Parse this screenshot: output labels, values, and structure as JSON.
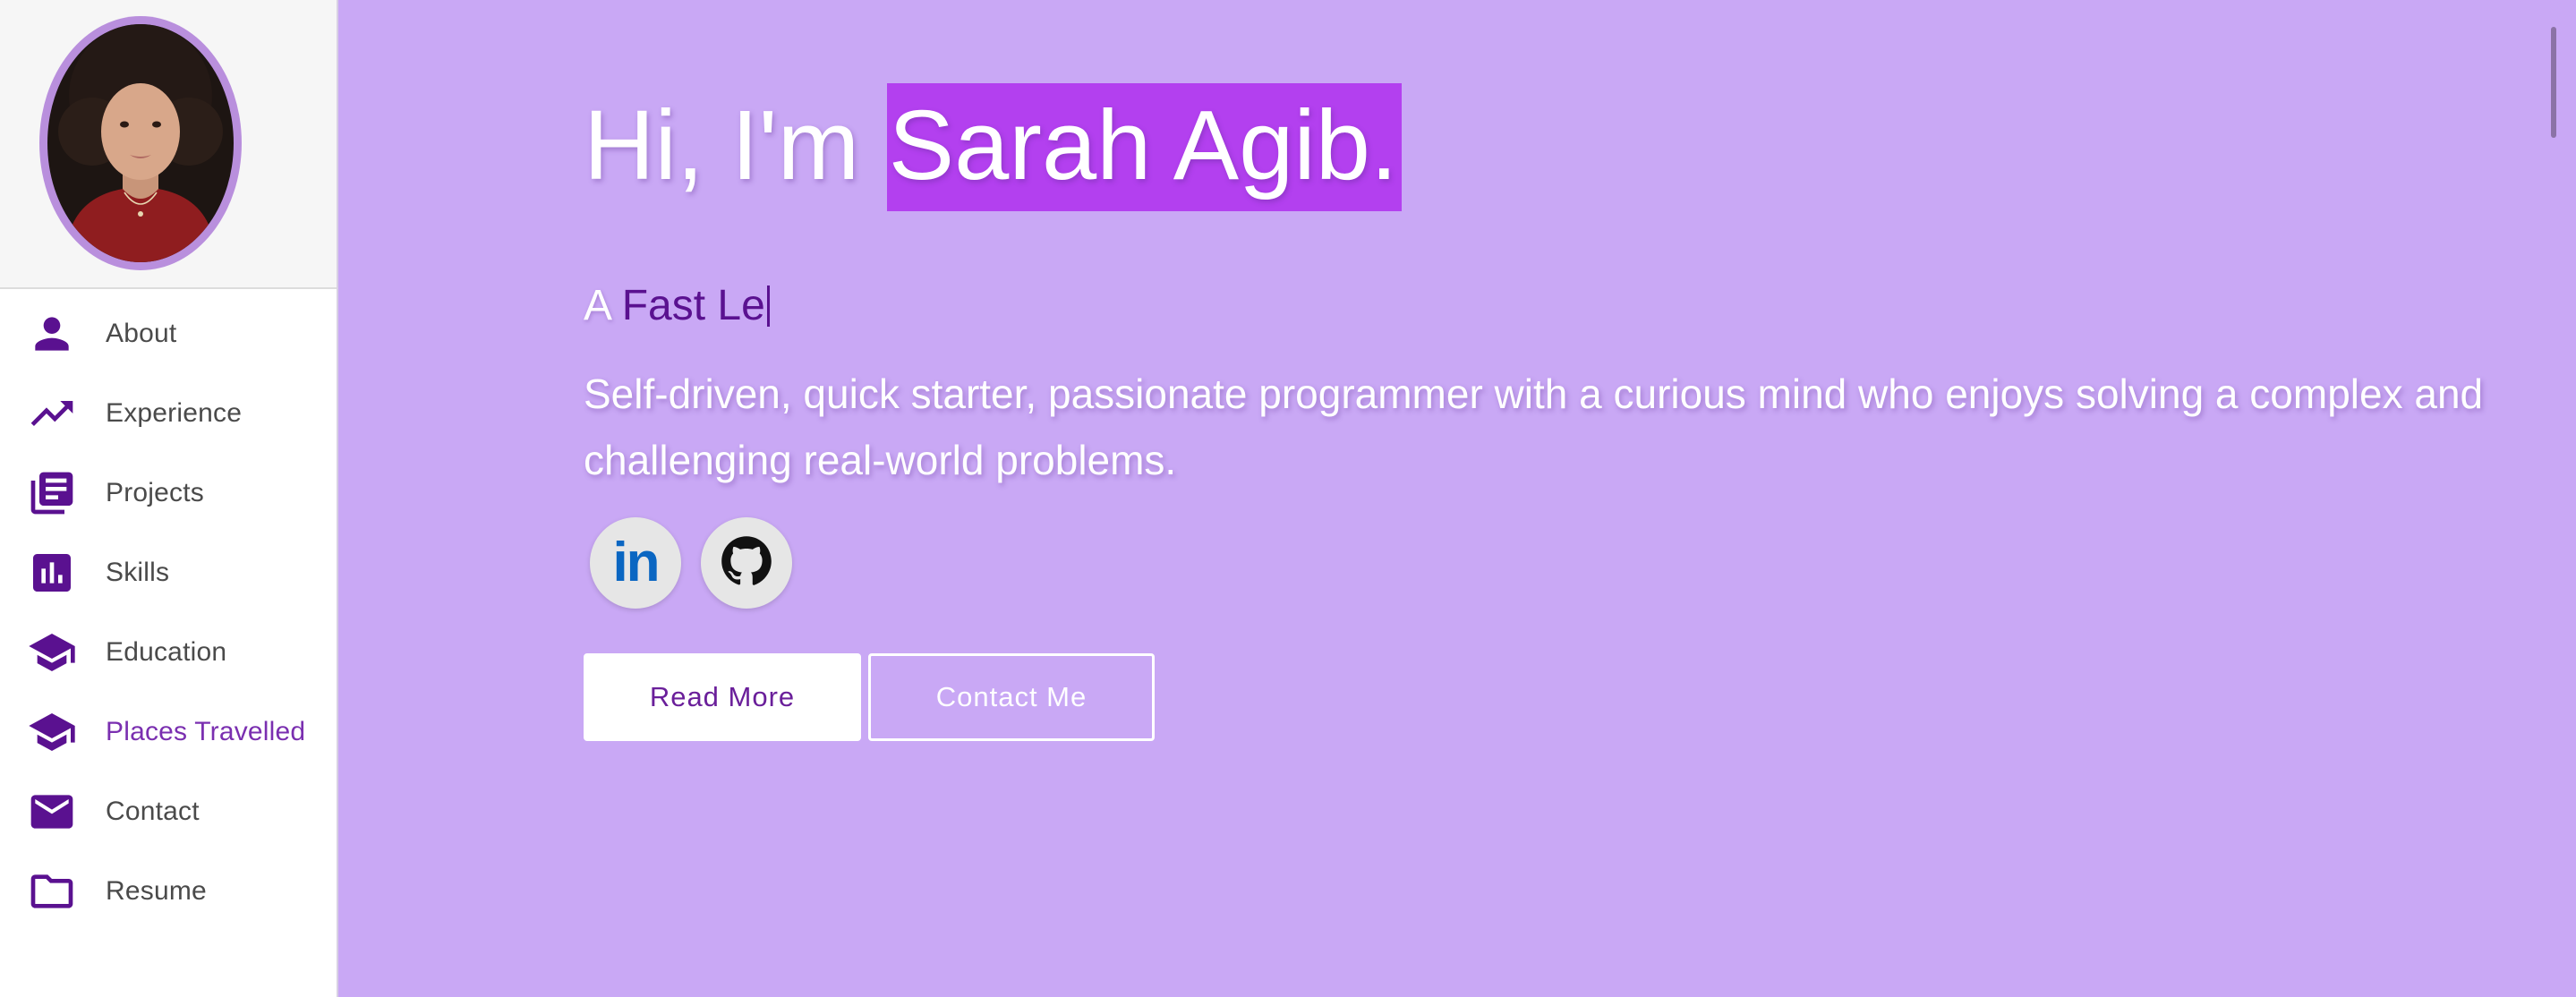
{
  "sidebar": {
    "avatar_alt": "Sarah Agib profile photo",
    "items": [
      {
        "label": "About",
        "icon": "person-icon"
      },
      {
        "label": "Experience",
        "icon": "trending-up-icon"
      },
      {
        "label": "Projects",
        "icon": "library-books-icon"
      },
      {
        "label": "Skills",
        "icon": "bar-chart-icon"
      },
      {
        "label": "Education",
        "icon": "school-icon"
      },
      {
        "label": "Places Travelled",
        "icon": "school-icon",
        "active": true
      },
      {
        "label": "Contact",
        "icon": "mail-icon"
      },
      {
        "label": "Resume",
        "icon": "folder-icon"
      }
    ]
  },
  "hero": {
    "greeting": "Hi, I'm ",
    "name": "Sarah Agib.",
    "typed_prefix": "A ",
    "typed_text": "Fast Le",
    "intro": "Self-driven, quick starter, passionate programmer with a curious mind who enjoys solving a complex and challenging real-world problems.",
    "social": [
      {
        "name": "linkedin",
        "glyph": "in"
      },
      {
        "name": "github"
      }
    ],
    "buttons": {
      "read_more": "Read More",
      "contact_me": "Contact Me"
    }
  },
  "colors": {
    "background": "#c9a8f5",
    "accent": "#5a1190",
    "highlight": "#b340ef",
    "active_nav": "#7a2fb0"
  }
}
